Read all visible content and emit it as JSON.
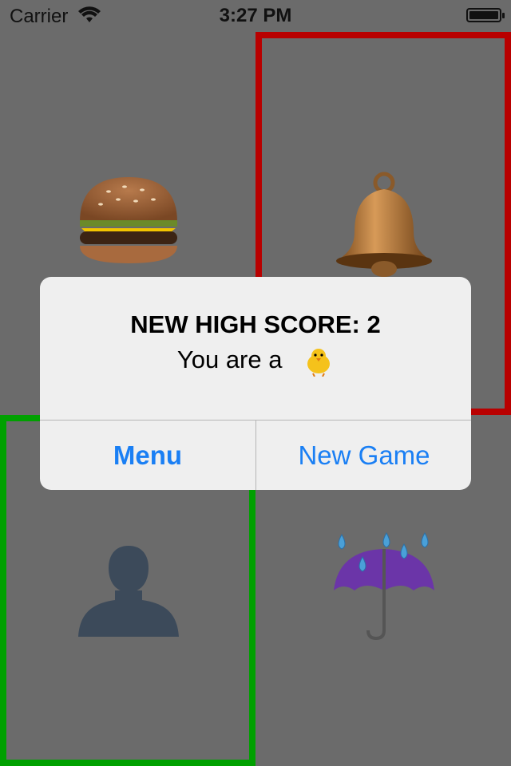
{
  "status_bar": {
    "carrier": "Carrier",
    "time": "3:27 PM",
    "wifi_icon": "wifi-icon",
    "battery_icon": "battery-icon"
  },
  "grid": {
    "top_left": {
      "emoji": "hamburger",
      "highlight": "none"
    },
    "top_right": {
      "emoji": "bell",
      "highlight": "#b80000"
    },
    "bottom_left": {
      "emoji": "person-silhouette",
      "highlight": "#00a000"
    },
    "bottom_right": {
      "emoji": "umbrella-with-rain",
      "highlight": "none"
    }
  },
  "alert": {
    "title": "NEW HIGH SCORE: 2",
    "message": "You are a",
    "message_emoji": "baby-chick",
    "buttons": {
      "menu": "Menu",
      "new_game": "New Game"
    }
  },
  "colors": {
    "background": "#6b6b6b",
    "button_text": "#1a7ff4",
    "wrong_highlight": "#b80000",
    "correct_highlight": "#00a000"
  }
}
